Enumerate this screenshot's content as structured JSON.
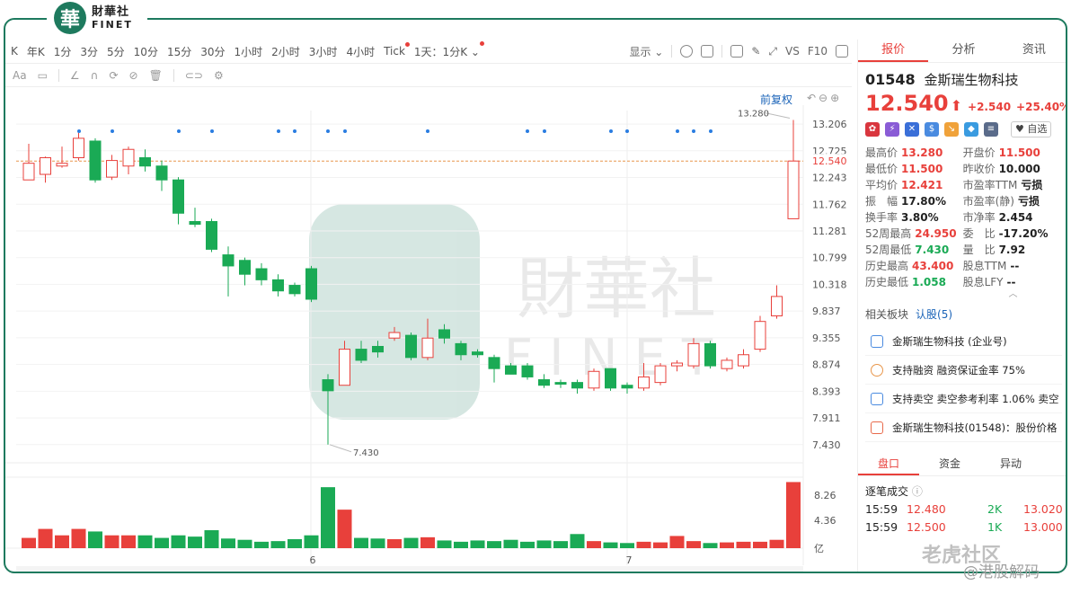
{
  "brand": {
    "seal_char": "華",
    "name_cn": "財華社",
    "name_en": "FINET"
  },
  "toolbar": {
    "timeframes": [
      "年K",
      "1分",
      "3分",
      "5分",
      "10分",
      "15分",
      "30分",
      "1小时",
      "2小时",
      "3小时",
      "4小时",
      "Tick",
      "1天：1分K"
    ],
    "prefix": "K",
    "display_label": "显示",
    "vs_label": "VS",
    "f10_label": "F10",
    "fq_label": "前复权"
  },
  "chart": {
    "price_axis": [
      "13.206",
      "12.725",
      "12.243",
      "11.762",
      "11.281",
      "10.799",
      "10.318",
      "9.837",
      "9.355",
      "8.874",
      "8.393",
      "7.911",
      "7.430"
    ],
    "current_price_label": "12.540",
    "high_annotation": "13.280",
    "low_annotation": "7.430",
    "volume_axis": [
      "8.26",
      "4.36",
      "亿"
    ],
    "date_labels": [
      "6",
      "7"
    ],
    "watermark_cn": "財華社",
    "watermark_en": "FINET",
    "colors": {
      "up": "#e8403b",
      "down": "#1aaa55",
      "price_line": "#e8964b",
      "marker": "#2a7de1"
    }
  },
  "panel": {
    "tabs": [
      "报价",
      "分析",
      "资讯"
    ],
    "code": "01548",
    "name": "金斯瑞生物科技",
    "price": "12.540",
    "change": "+2.540",
    "change_pct": "+25.40%",
    "fav_label": "自选",
    "quote": [
      [
        {
          "label": "最高价",
          "value": "13.280",
          "color": "red"
        },
        {
          "label": "开盘价",
          "value": "11.500",
          "color": "red"
        }
      ],
      [
        {
          "label": "最低价",
          "value": "11.500",
          "color": "red"
        },
        {
          "label": "昨收价",
          "value": "10.000",
          "color": "dark"
        }
      ],
      [
        {
          "label": "平均价",
          "value": "12.421",
          "color": "red"
        },
        {
          "label": "市盈率TTM",
          "value": "亏损",
          "color": "dark"
        }
      ],
      [
        {
          "label": "振　幅",
          "value": "17.80%",
          "color": "dark"
        },
        {
          "label": "市盈率(静)",
          "value": "亏损",
          "color": "dark"
        }
      ],
      [
        {
          "label": "换手率",
          "value": "3.80%",
          "color": "dark"
        },
        {
          "label": "市净率",
          "value": "2.454",
          "color": "dark"
        }
      ],
      [
        {
          "label": "52周最高",
          "value": "24.950",
          "color": "red"
        },
        {
          "label": "委　比",
          "value": "-17.20%",
          "color": "dark"
        }
      ],
      [
        {
          "label": "52周最低",
          "value": "7.430",
          "color": "grn"
        },
        {
          "label": "量　比",
          "value": "7.92",
          "color": "dark"
        }
      ],
      [
        {
          "label": "历史最高",
          "value": "43.400",
          "color": "red"
        },
        {
          "label": "股息TTM",
          "value": "--",
          "color": "dark"
        }
      ],
      [
        {
          "label": "历史最低",
          "value": "1.058",
          "color": "grn"
        },
        {
          "label": "股息LFY",
          "value": "--",
          "color": "dark"
        }
      ]
    ],
    "plates_label": "相关板块",
    "plates_link": "认股(5)",
    "news": [
      "金斯瑞生物科技 (企业号)",
      "支持融资 融资保证金率 75%",
      "支持卖空 卖空参考利率 1.06% 卖空",
      "金斯瑞生物科技(01548)：股份价格"
    ],
    "tabs2": [
      "盘口",
      "资金",
      "异动"
    ],
    "trade_title": "逐笔成交",
    "trades": [
      {
        "time": "15:59",
        "price": "12.480",
        "qty": "2K",
        "p2": "13.020"
      },
      {
        "time": "15:59",
        "price": "12.500",
        "qty": "1K",
        "p2": "13.000"
      }
    ]
  },
  "watermarks": {
    "lao": "老虎社区",
    "bottom": "@港股解码"
  }
}
